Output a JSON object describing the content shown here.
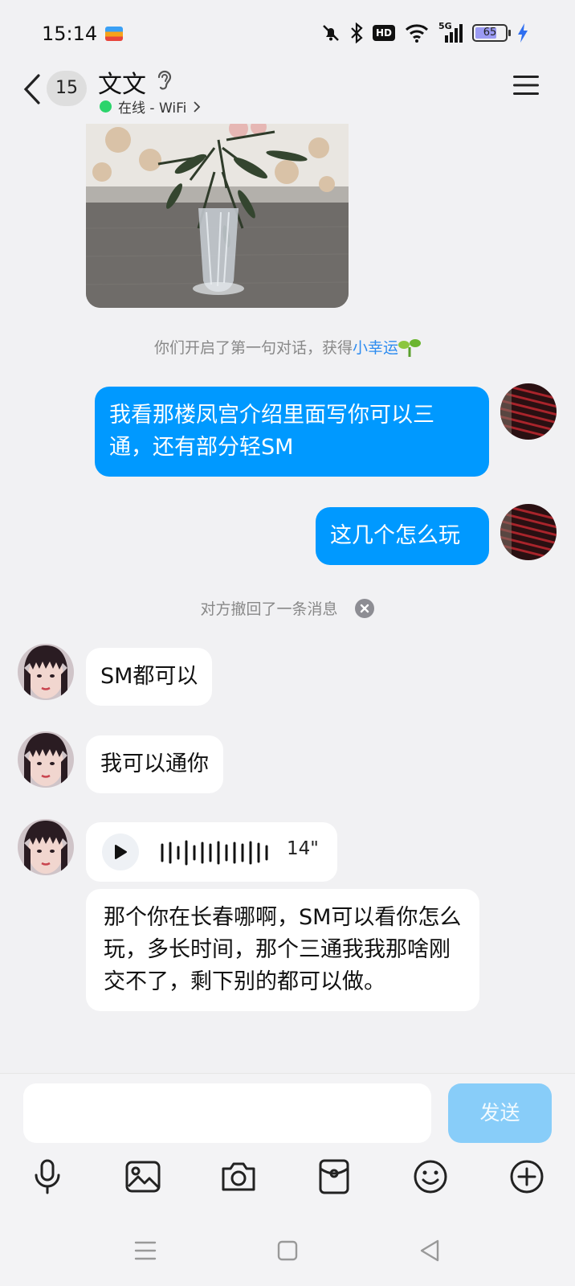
{
  "status_bar": {
    "time": "15:14",
    "hd_label": "HD",
    "network": "5G",
    "battery": "65",
    "battery_level": 0.65
  },
  "header": {
    "unread_count": "15",
    "contact_name": "文文",
    "online_status": "在线 - WiFi"
  },
  "chat": {
    "system_notice": {
      "prefix": "你们开启了第一句对话，获得",
      "link": "小幸运"
    },
    "outgoing": [
      {
        "text": "我看那楼凤宫介绍里面写你可以三通，还有部分轻SM"
      },
      {
        "text": "这几个怎么玩"
      }
    ],
    "recall_notice": "对方撤回了一条消息",
    "incoming": [
      {
        "text": "SM都可以"
      },
      {
        "text": "我可以通你"
      }
    ],
    "voice_message": {
      "duration": "14\""
    },
    "transcription": "那个你在长春哪啊，SM可以看你怎么玩，多长时间，那个三通我我那啥刚交不了，剩下别的都可以做。"
  },
  "input": {
    "placeholder": "",
    "value": "",
    "send_label": "发送"
  },
  "toolbar": {
    "icons": [
      "microphone-icon",
      "image-icon",
      "camera-icon",
      "red-packet-icon",
      "emoji-icon",
      "plus-icon"
    ]
  },
  "colors": {
    "accent": "#0099ff",
    "send_disabled": "#88cdf9",
    "online": "#2bd46b",
    "link": "#2d8cf0"
  }
}
